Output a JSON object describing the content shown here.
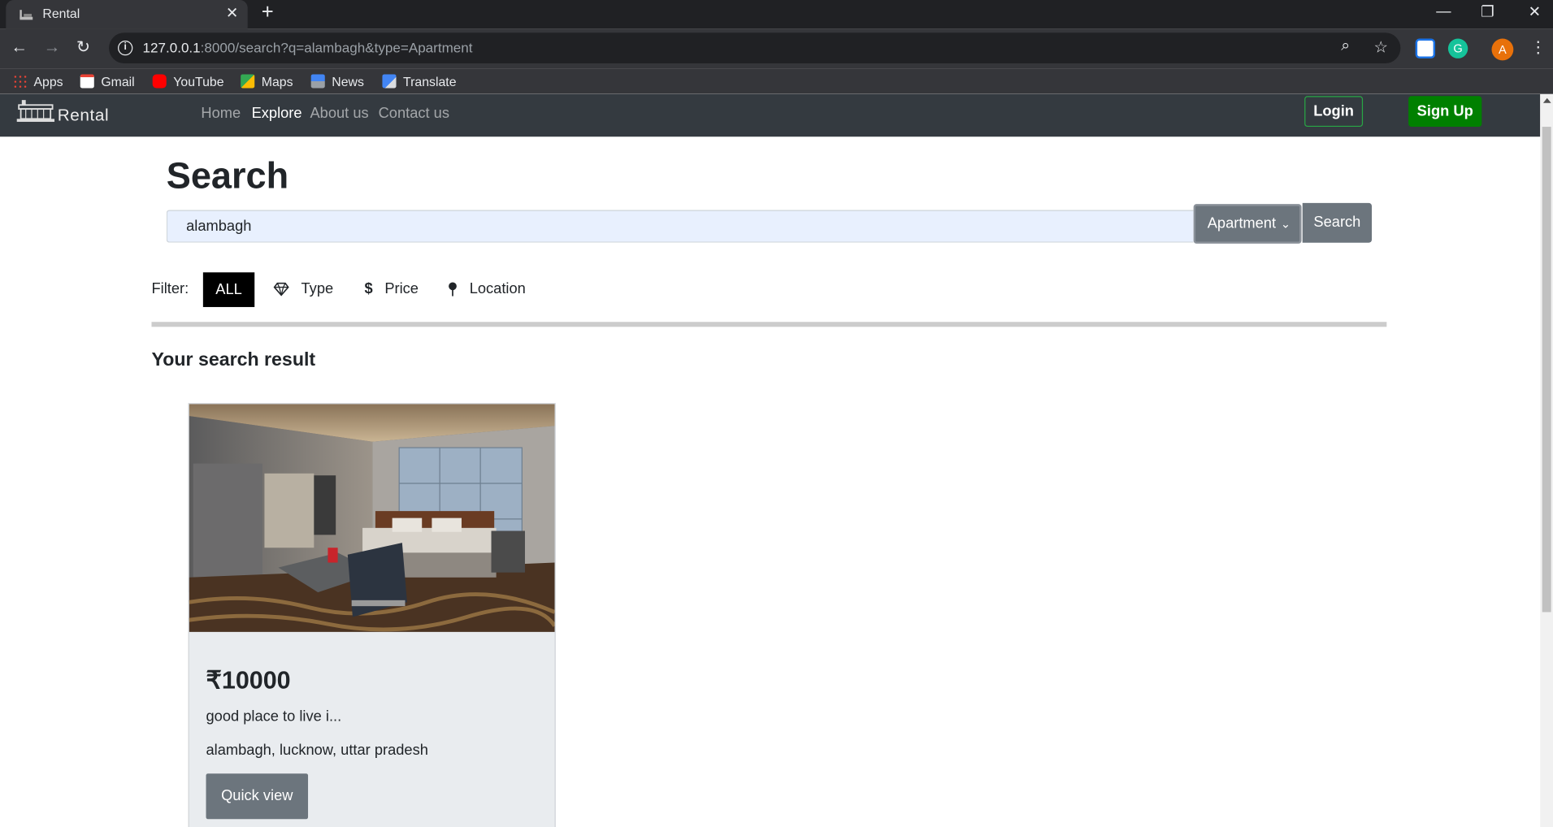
{
  "browser": {
    "tab_title": "Rental",
    "url_host": "127.0.0.1",
    "url_rest": ":8000/search?q=alambagh&type=Apartment",
    "avatar_letter": "A"
  },
  "bookmarks": [
    {
      "label": "Apps",
      "icon": "apps-grid-icon",
      "color": "#ea4335"
    },
    {
      "label": "Gmail",
      "icon": "gmail-icon",
      "color": "#ea4335"
    },
    {
      "label": "YouTube",
      "icon": "youtube-icon",
      "color": "#ff0000"
    },
    {
      "label": "Maps",
      "icon": "maps-icon",
      "color": "#34a853"
    },
    {
      "label": "News",
      "icon": "news-icon",
      "color": "#4285f4"
    },
    {
      "label": "Translate",
      "icon": "translate-icon",
      "color": "#4285f4"
    }
  ],
  "site": {
    "brand": "Rental",
    "nav": [
      "Home",
      "Explore",
      "About us",
      "Contact us"
    ],
    "active_nav": "Explore",
    "login_label": "Login",
    "signup_label": "Sign Up"
  },
  "search": {
    "title": "Search",
    "query": "alambagh",
    "type_selected": "Apartment",
    "button_label": "Search"
  },
  "filter": {
    "label": "Filter:",
    "all_label": "ALL",
    "chips": [
      {
        "label": "Type",
        "icon": "diamond-icon"
      },
      {
        "label": "Price",
        "icon": "dollar-icon"
      },
      {
        "label": "Location",
        "icon": "pin-icon"
      }
    ]
  },
  "results": {
    "heading": "Your search result",
    "cards": [
      {
        "price": "₹10000",
        "description": "good place to live i...",
        "location": "alambagh, lucknow, uttar pradesh",
        "button_label": "Quick view"
      }
    ]
  },
  "colors": {
    "navbar": "#343a40",
    "signup": "#008000",
    "login_border": "#28a745",
    "secondary_btn": "#6c757d",
    "card_bg": "#e9ecef"
  }
}
